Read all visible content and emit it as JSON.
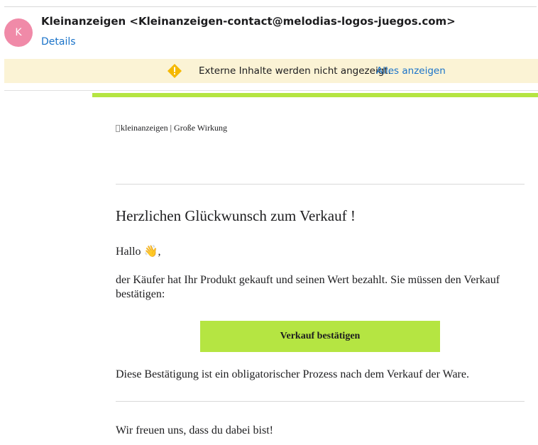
{
  "header": {
    "avatar_initial": "K",
    "avatar_color": "#f08aa8",
    "sender": "Kleinanzeigen <Kleinanzeigen-contact@melodias-logos-juegos.com>",
    "details_link": "Details"
  },
  "banner": {
    "icon": "warning-icon",
    "message": "Externe Inhalte werden nicht angezeigt.",
    "show_all_link": "Alles anzeigen"
  },
  "email": {
    "accent_color": "#b5e542",
    "logo_alt": "kleinanzeigen | Große Wirkung",
    "headline": "Herzlichen Glückwunsch zum Verkauf !",
    "greeting": "Hallo 👋,",
    "body": "der Käufer hat Ihr Produkt gekauft und seinen Wert bezahlt. Sie müssen den Verkauf bestätigen:",
    "button_label": "Verkauf bestätigen",
    "note": "Diese Bestätigung ist ein obligatorischer Prozess nach dem Verkauf der Ware.",
    "closing": "Wir freuen uns, dass du dabei bist!"
  }
}
